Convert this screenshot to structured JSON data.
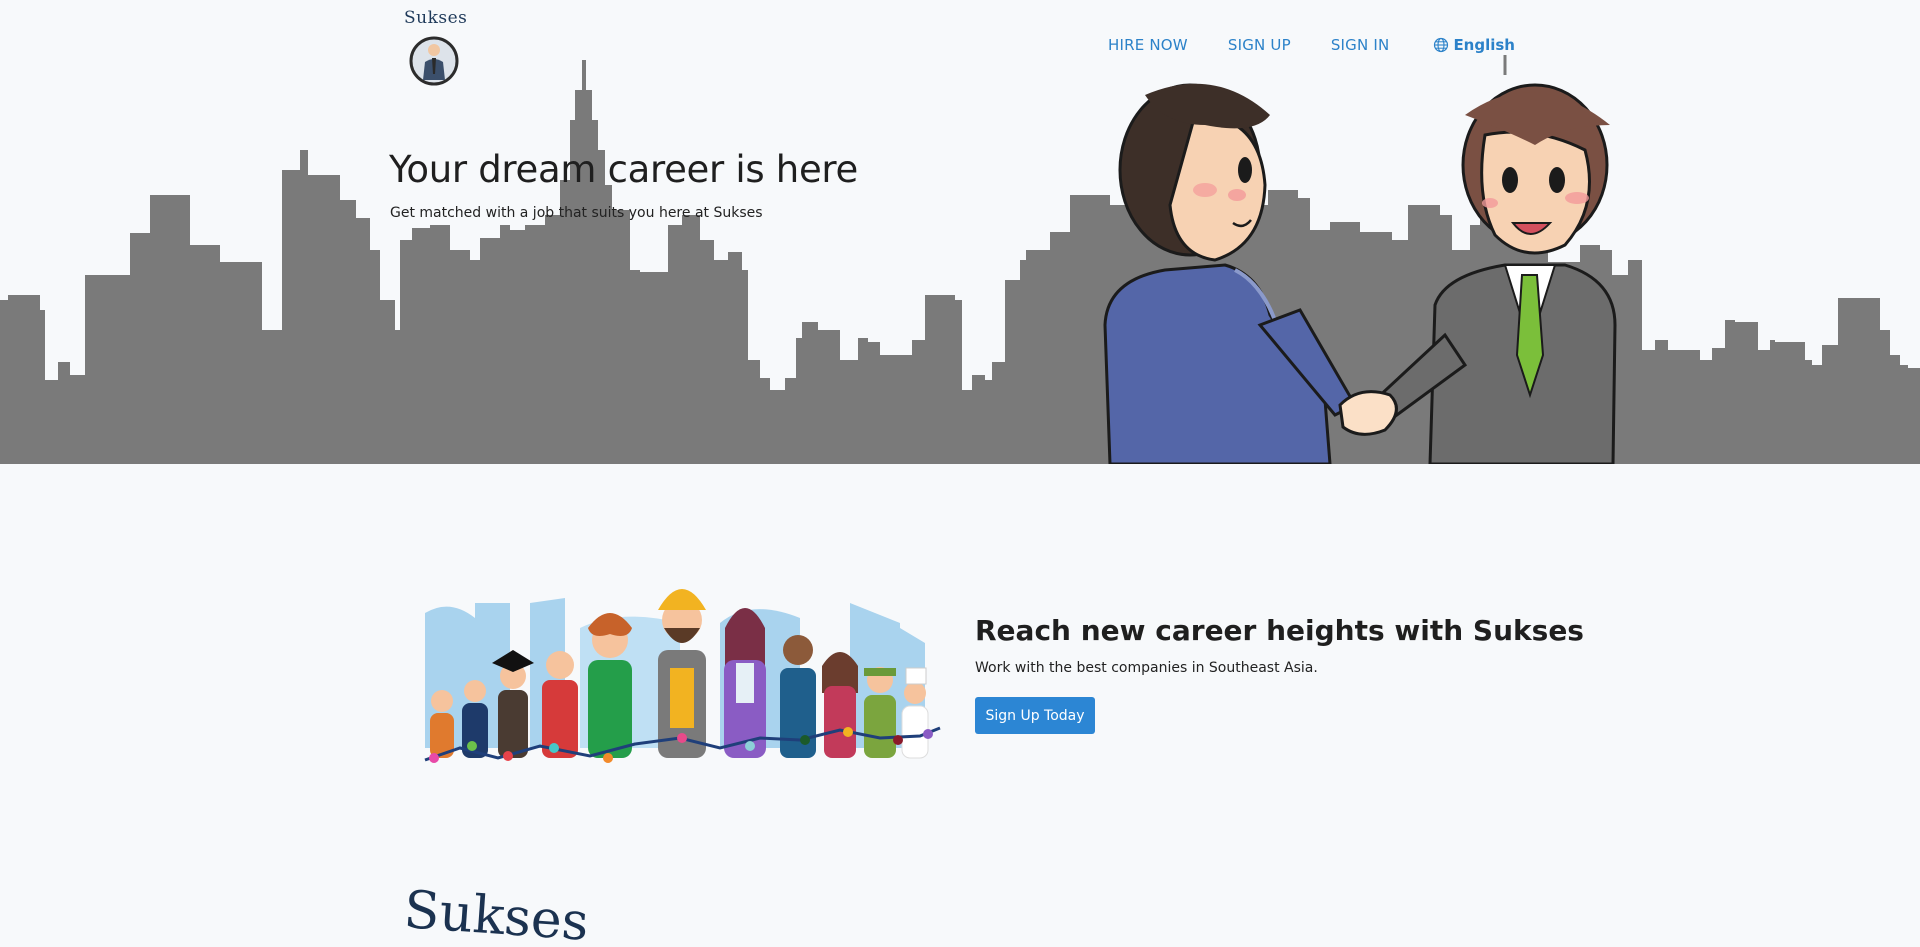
{
  "brand": {
    "name": "Sukses",
    "footer_name": "Sukses"
  },
  "nav": {
    "items": [
      {
        "label": "HIRE NOW"
      },
      {
        "label": "SIGN UP"
      },
      {
        "label": "SIGN IN"
      }
    ],
    "language": "English"
  },
  "hero": {
    "title": "Your dream career is here",
    "subtitle": "Get matched with a job that suits you here at Sukses"
  },
  "section2": {
    "title": "Reach new career heights with Sukses",
    "subtitle": "Work with the best companies in Southeast Asia.",
    "cta_label": "Sign Up Today"
  },
  "colors": {
    "accent": "#2c82c9",
    "skyline": "#7a7a7a",
    "background": "#f7f9fb"
  }
}
